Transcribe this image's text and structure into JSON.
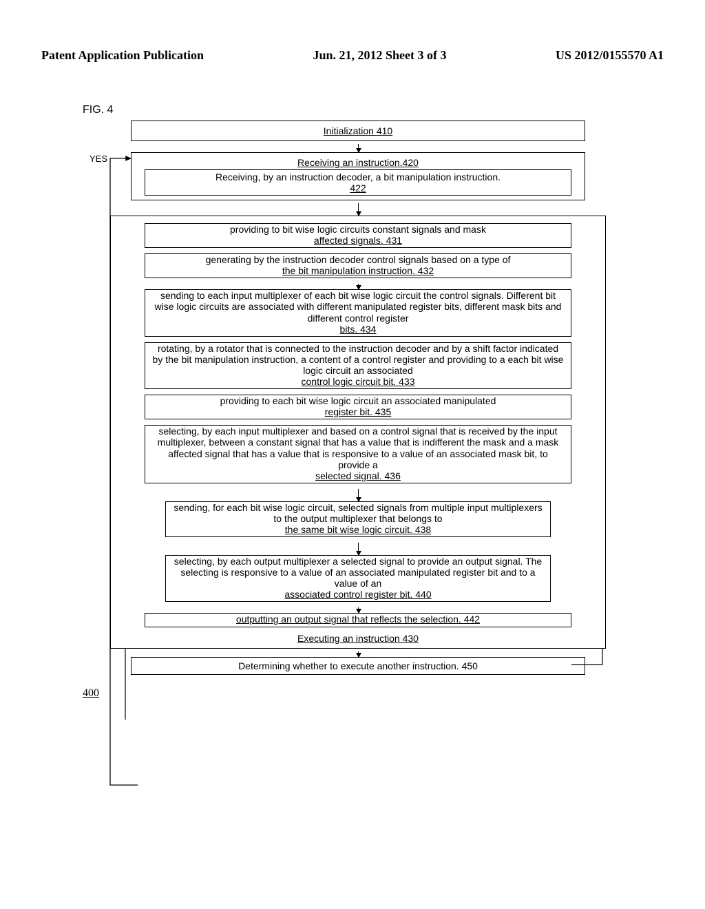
{
  "header": {
    "left": "Patent Application Publication",
    "center": "Jun. 21, 2012  Sheet 3 of 3",
    "right": "US 2012/0155570 A1"
  },
  "figure_label": "FIG. 4",
  "yes_label": "YES",
  "ref_number": "400",
  "boxes": {
    "init": "Initialization 410",
    "recv_outer_title": "Receiving an instruction.420",
    "recv_inner": "Receiving, by an instruction decoder, a bit manipulation instruction. 422",
    "exec": {
      "b431": "providing to bit wise logic circuits constant signals and mask affected signals.  431",
      "b432": "generating by the instruction decoder control signals based on a type of the bit manipulation instruction. 432",
      "b434": "sending to each input multiplexer of each bit wise logic circuit the control signals. Different bit wise logic circuits are associated with different manipulated register bits, different mask bits and different control register bits. 434",
      "b433": "rotating, by a rotator that is connected to the instruction decoder and by a shift factor indicated by the bit manipulation instruction, a content of a control register and providing to a each bit wise logic circuit an associated control logic circuit bit. 433",
      "b435": "providing to each bit wise logic circuit an associated manipulated register bit. 435",
      "b436": "selecting, by each input multiplexer and based on a control signal that is received by the input multiplexer, between a constant signal that has a value that is indifferent the mask and a mask affected signal that has a value that is responsive to a value of an associated mask bit, to provide a selected signal. 436",
      "b438": "sending, for each bit wise logic circuit, selected signals from multiple input multiplexers to the output multiplexer that belongs to the same bit wise logic circuit. 438",
      "b440": "selecting, by each output multiplexer a selected signal to provide an output signal. The selecting is responsive to a value of an associated manipulated register bit and to a value of an associated control register bit. 440",
      "b442": "outputting an output signal that reflects the selection. 442",
      "title": "Executing an instruction 430"
    },
    "decide": "Determining whether to execute another instruction. 450"
  }
}
